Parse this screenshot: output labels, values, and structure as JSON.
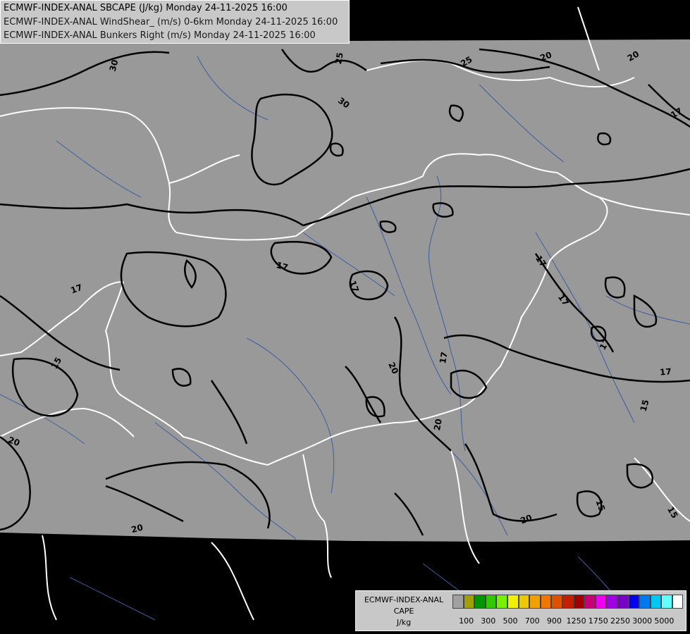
{
  "header": {
    "line1": "ECMWF-INDEX-ANAL SBCAPE (J/kg) Monday 24-11-2025 16:00",
    "line2": "ECMWF-INDEX-ANAL WindShear_ (m/s) 0-6km Monday 24-11-2025 16:00",
    "line3": "ECMWF-INDEX-ANAL Bunkers Right (m/s) Monday 24-11-2025 16:00"
  },
  "legend": {
    "title1": "ECMWF-INDEX-ANAL",
    "title2": "CAPE",
    "unit": "J/kg",
    "colors": [
      "#a0a0a0",
      "#a0a000",
      "#009600",
      "#32c800",
      "#78f000",
      "#f0f000",
      "#f0c800",
      "#f0a000",
      "#f07800",
      "#e05000",
      "#c81e00",
      "#a00000",
      "#c80078",
      "#f000f0",
      "#a000e6",
      "#7800c8",
      "#0000f0",
      "#0078f0",
      "#00c8f0",
      "#64ffff",
      "#ffffff"
    ],
    "labels": [
      "100",
      "300",
      "500",
      "700",
      "900",
      "1250",
      "1750",
      "2250",
      "3000",
      "5000"
    ]
  },
  "map": {
    "contour_labels": [
      "30",
      "25",
      "25",
      "30",
      "20",
      "20",
      "17",
      "17",
      "17",
      "17",
      "17",
      "17",
      "15",
      "20",
      "20",
      "20",
      "17",
      "17",
      "17",
      "15",
      "20",
      "15",
      "15",
      "20"
    ],
    "colors": {
      "land_gray": "#999999",
      "outside": "#000000",
      "borders": "#ffffff",
      "rivers": "#3a5fa0",
      "contours": "#000000"
    }
  }
}
